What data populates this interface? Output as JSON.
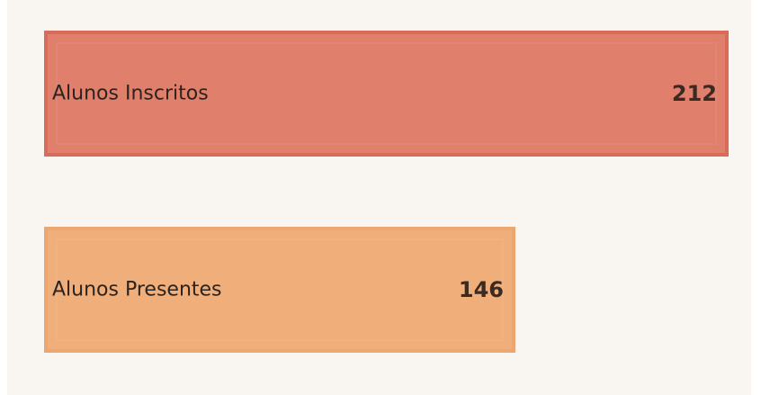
{
  "chart_data": {
    "type": "bar",
    "orientation": "horizontal",
    "categories": [
      "Alunos Inscritos",
      "Alunos Presentes"
    ],
    "values": [
      212,
      146
    ],
    "colors": [
      "#e07f6b",
      "#f0ae7a"
    ],
    "border_colors": [
      "#d96c58",
      "#eda66f"
    ],
    "xlim": [
      0,
      212
    ],
    "title": "",
    "xlabel": "",
    "ylabel": "",
    "grid": false,
    "legend": "none"
  }
}
